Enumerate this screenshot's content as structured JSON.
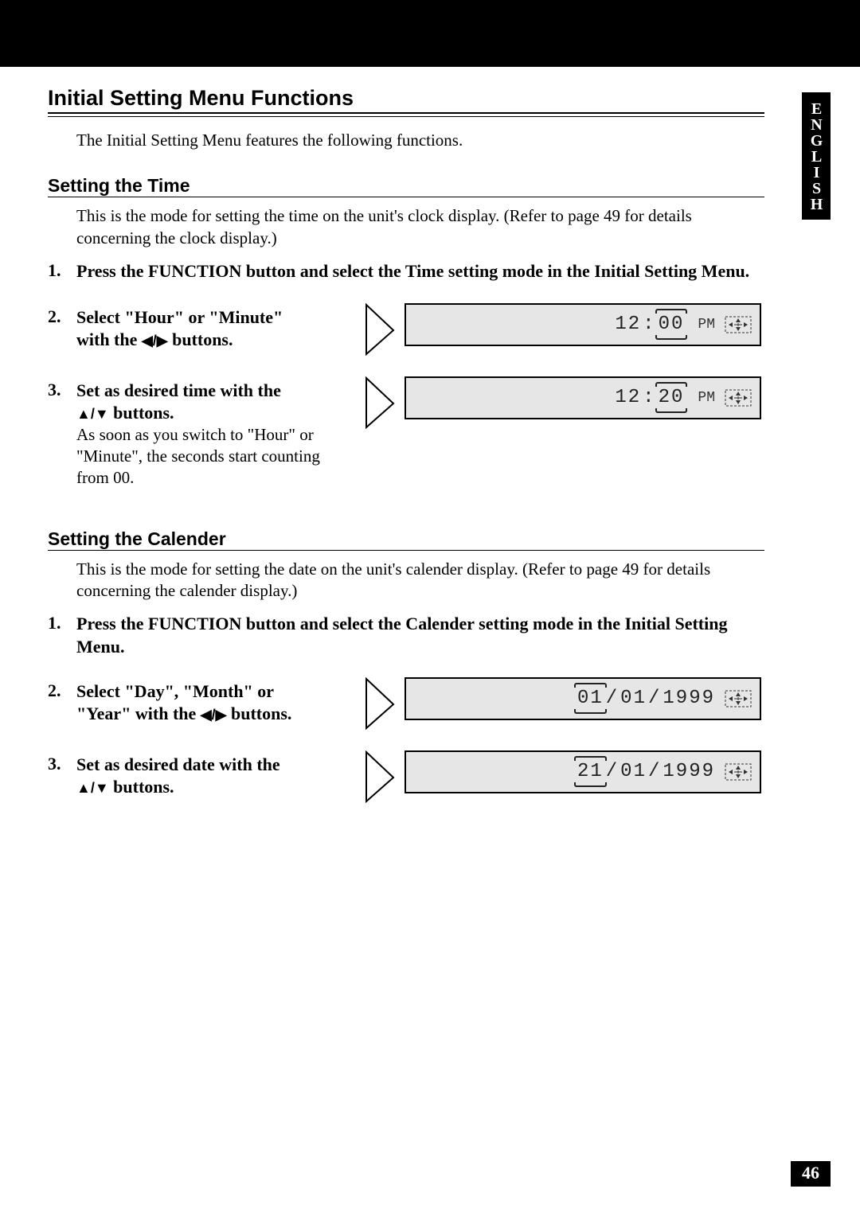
{
  "language_tab": "ENGLISH",
  "page_number": "46",
  "title": "Initial Setting Menu Functions",
  "intro": "The Initial Setting Menu features the following functions.",
  "time": {
    "heading": "Setting the Time",
    "intro": "This is the mode for setting the time on the unit's clock display. (Refer to page 49 for details concerning the clock display.)",
    "step1": "Press the FUNCTION button and select the Time setting mode in the Initial Setting Menu.",
    "step2_a": "Select \"Hour\" or \"Minute\"",
    "step2_b": "with the ",
    "step2_c": " buttons.",
    "step3_a": "Set as desired time with the",
    "step3_b": " buttons.",
    "step3_note": "As soon as you switch to \"Hour\" or \"Minute\", the seconds start counting from 00.",
    "lcd1_hour": "12",
    "lcd1_colon": ":",
    "lcd1_min": "00",
    "lcd1_ampm": "PM",
    "lcd2_hour": "12",
    "lcd2_colon": ":",
    "lcd2_min": "20",
    "lcd2_ampm": "PM"
  },
  "calendar": {
    "heading": "Setting the Calender",
    "intro": "This is the mode for setting the date on the unit's calender display. (Refer to page 49 for details concerning the calender display.)",
    "step1": "Press the FUNCTION button and select the Calender setting mode in the Initial Setting Menu.",
    "step2_a": "Select \"Day\", \"Month\" or",
    "step2_b": "\"Year\" with the ",
    "step2_c": " buttons.",
    "step3_a": "Set as desired date with the",
    "step3_b": " buttons.",
    "lcd1_day": "01",
    "lcd1_sep1": "/",
    "lcd1_month": "01",
    "lcd1_sep2": "/",
    "lcd1_year": "1999",
    "lcd2_day": "21",
    "lcd2_sep1": "/",
    "lcd2_month": "01",
    "lcd2_sep2": "/",
    "lcd2_year": "1999"
  },
  "glyphs": {
    "left_right": "◀/▶",
    "up_down": "▲/▼"
  }
}
